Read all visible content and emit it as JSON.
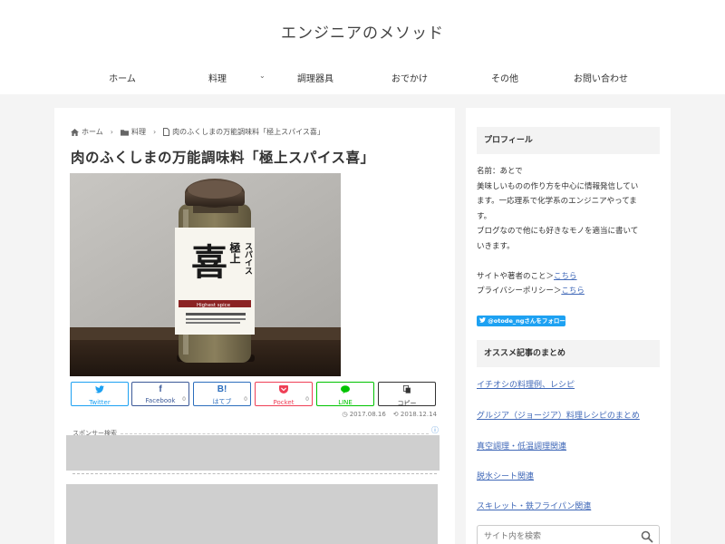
{
  "site": {
    "title": "エンジニアのメソッド"
  },
  "nav": {
    "items": [
      {
        "label": "ホーム"
      },
      {
        "label": "料理"
      },
      {
        "label": "調理器具"
      },
      {
        "label": "おでかけ"
      },
      {
        "label": "その他"
      },
      {
        "label": "お問い合わせ"
      }
    ]
  },
  "breadcrumb": {
    "home": "ホーム",
    "category": "料理",
    "current": "肉のふくしまの万能調味料「極上スパイス喜」"
  },
  "article": {
    "title": "肉のふくしまの万能調味料「極上スパイス喜」",
    "label_vertical_1": "極上",
    "label_vertical_2": "スパイス",
    "label_kanji": "喜",
    "label_band": "Highest spice",
    "published": "2017.08.16",
    "updated": "2018.12.14"
  },
  "share": [
    {
      "icon": "twitter-icon",
      "label": "Twitter",
      "count": "",
      "color": "#1da1f2"
    },
    {
      "icon": "facebook-icon",
      "label": "Facebook",
      "count": "0",
      "color": "#3b5998"
    },
    {
      "icon": "hatena-icon",
      "label": "はてブ",
      "count": "0",
      "color": "#2c6ebd"
    },
    {
      "icon": "pocket-icon",
      "label": "Pocket",
      "count": "0",
      "color": "#ef3f56"
    },
    {
      "icon": "line-icon",
      "label": "LINE",
      "count": "",
      "color": "#00c300"
    },
    {
      "icon": "copy-icon",
      "label": "コピー",
      "count": "",
      "color": "#333333"
    }
  ],
  "ad": {
    "label": "スポンサー検索"
  },
  "sidebar": {
    "profile_title": "プロフィール",
    "profile_lines": [
      "名前：あとで",
      "美味しいものの作り方を中心に情報発信してい",
      "ます。一応理系で化学系のエンジニアやってま",
      "す。",
      "ブログなので他にも好きなモノを適当に書いて",
      "いきます。"
    ],
    "links_line1_prefix": "サイトや著者のこと＞",
    "links_line1_link": "こちら",
    "links_line2_prefix": "プライバシーポリシー＞",
    "links_line2_link": "こちら",
    "follow_label": "@otode_ngさんをフォロー",
    "recommend_title": "オススメ記事のまとめ",
    "recommend_links": [
      "イチオシの料理例、レシピ",
      "グルジア（ジョージア）料理レシピのまとめ",
      "真空調理・低温調理関連",
      "脱水シート関連",
      "スキレット・鉄フライパン関連"
    ],
    "search_placeholder": "サイト内を検索"
  }
}
